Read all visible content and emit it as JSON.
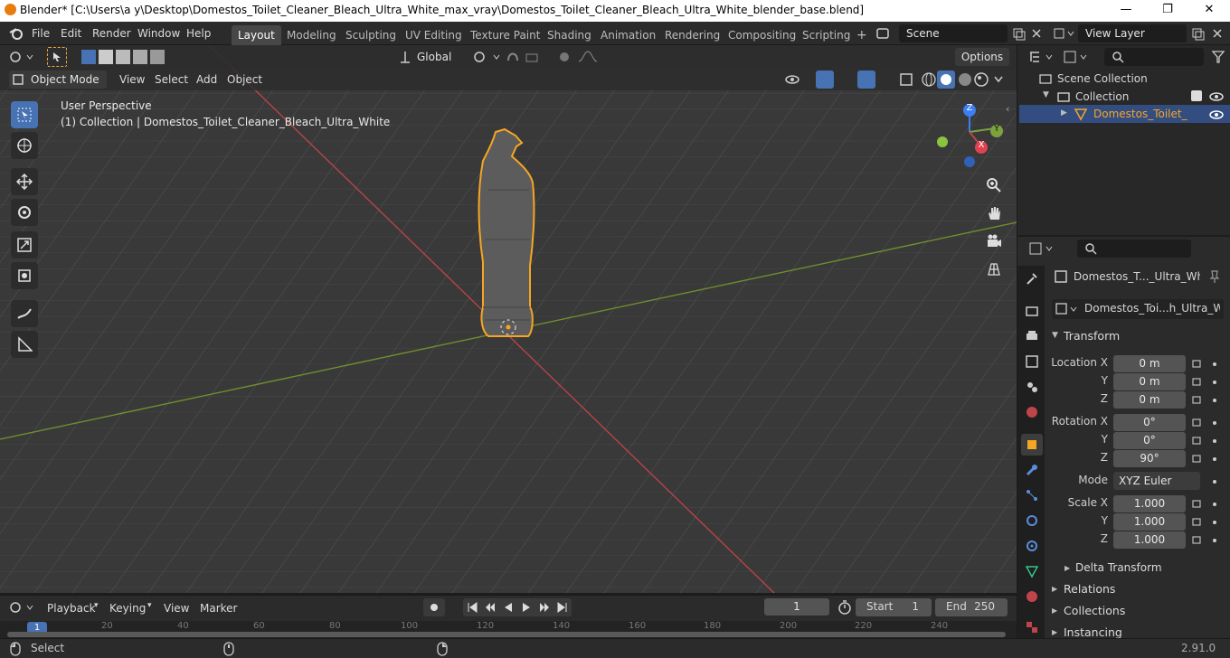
{
  "window": {
    "title": "Blender* [C:\\Users\\a y\\Desktop\\Domestos_Toilet_Cleaner_Bleach_Ultra_White_max_vray\\Domestos_Toilet_Cleaner_Bleach_Ultra_White_blender_base.blend]",
    "minimize": "—",
    "maximize": "❐",
    "close": "✕"
  },
  "menubar": {
    "items": [
      "File",
      "Edit",
      "Render",
      "Window",
      "Help"
    ]
  },
  "workspaces": [
    "Layout",
    "Modeling",
    "Sculpting",
    "UV Editing",
    "Texture Paint",
    "Shading",
    "Animation",
    "Rendering",
    "Compositing",
    "Scripting"
  ],
  "workspace_add": "+",
  "scene": {
    "name": "Scene"
  },
  "view_layer": {
    "name": "View Layer"
  },
  "viewport_header": {
    "transform_orientation": "Global",
    "options": "Options",
    "mode": "Object Mode",
    "menus": [
      "View",
      "Select",
      "Add",
      "Object"
    ]
  },
  "viewport": {
    "perspective_label": "User Perspective",
    "collection_label": "(1) Collection | Domestos_Toilet_Cleaner_Bleach_Ultra_White",
    "gizmo": {
      "z": "Z",
      "y": "Y",
      "x": "X"
    }
  },
  "outliner": {
    "scene_collection": "Scene Collection",
    "collection": "Collection",
    "object": "Domestos_Toilet_Cle"
  },
  "properties": {
    "object_name": "Domestos_T..._Ultra_Whit",
    "data_name": "Domestos_Toi...h_Ultra_White",
    "transform_header": "Transform",
    "location": {
      "label_x": "Location X",
      "label_y": "Y",
      "label_z": "Z",
      "x": "0 m",
      "y": "0 m",
      "z": "0 m"
    },
    "rotation": {
      "label_x": "Rotation X",
      "label_y": "Y",
      "label_z": "Z",
      "x": "0°",
      "y": "0°",
      "z": "90°"
    },
    "mode": {
      "label": "Mode",
      "value": "XYZ Euler"
    },
    "scale": {
      "label_x": "Scale X",
      "label_y": "Y",
      "label_z": "Z",
      "x": "1.000",
      "y": "1.000",
      "z": "1.000"
    },
    "delta_transform": "Delta Transform",
    "relations": "Relations",
    "collections": "Collections",
    "instancing": "Instancing"
  },
  "timeline": {
    "menus": [
      "Playback",
      "Keying",
      "View",
      "Marker"
    ],
    "current_frame": "1",
    "start_label": "Start",
    "start": "1",
    "end_label": "End",
    "end": "250",
    "ruler": [
      "1",
      "20",
      "40",
      "60",
      "80",
      "100",
      "120",
      "140",
      "160",
      "180",
      "200",
      "220",
      "240"
    ]
  },
  "status": {
    "select": "Select",
    "version": "2.91.0"
  },
  "colors": {
    "accent": "#4772b3",
    "selection_outline": "#f5a623",
    "x_axis": "#c0444a",
    "y_axis": "#7ba23c",
    "z_axis": "#3d7ff0"
  }
}
